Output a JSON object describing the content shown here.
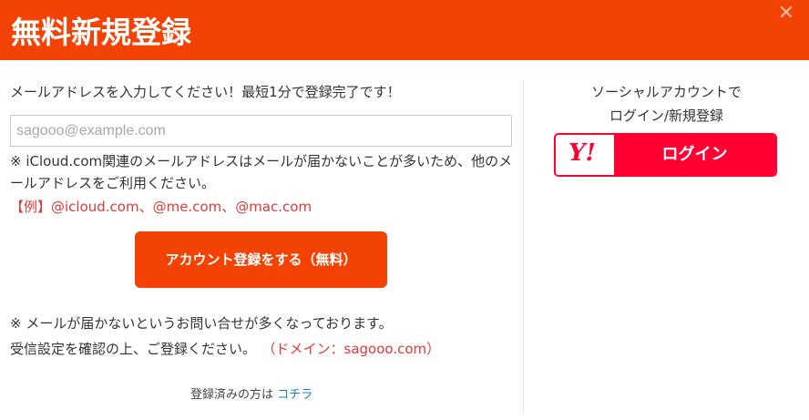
{
  "header": {
    "title": "無料新規登録",
    "close_symbol": "✕"
  },
  "form": {
    "intro": "メールアドレスを入力してください！最短1分で登録完了です！",
    "email_placeholder": "sagooo@example.com",
    "email_value": "",
    "icloud_note": "※ iCloud.com関連のメールアドレスはメールが届かないことが多いため、他のメールアドレスをご利用ください。",
    "example": "【例】@icloud.com、@me.com、@mac.com",
    "register_button": "アカウント登録をする（無料）",
    "notice_line1": "※ メールが届かないというお問い合せが多くなっております。",
    "notice_line2": "受信設定を確認の上、ご登録ください。",
    "notice_domain": "（ドメイン：sagooo.com）",
    "already_text": "登録済みの方は",
    "already_link": "コチラ"
  },
  "social": {
    "title_line1": "ソーシャルアカウントで",
    "title_line2": "ログイン/新規登録",
    "yahoo_logo_text": "Y!",
    "yahoo_login_label": "ログイン"
  },
  "colors": {
    "brand": "#f24304",
    "link": "#1a7fc1",
    "warning": "#e03a3a",
    "yahoo": "#ff0033"
  }
}
